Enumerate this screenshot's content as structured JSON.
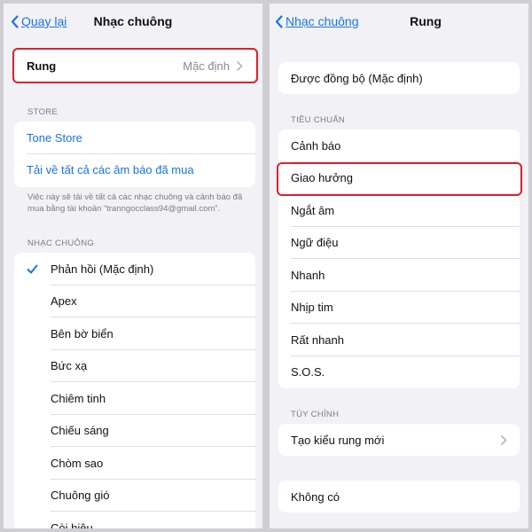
{
  "left": {
    "nav": {
      "back_label": "Quay lại",
      "title": "Nhạc chuông"
    },
    "vibration_row": {
      "label": "Rung",
      "value": "Mặc định"
    },
    "store": {
      "section_label": "STORE",
      "tone_store": "Tone Store",
      "download_all": "Tải về tất cả các âm báo đã mua",
      "footnote": "Việc này sẽ tải về tất cả các nhạc chuông và cảnh báo đã mua bằng tài khoản “tranngocclass94@gmail.com”."
    },
    "ringtones": {
      "section_label": "NHẠC CHUÔNG",
      "items": [
        {
          "label": "Phản hồi (Mặc định)",
          "selected": true
        },
        {
          "label": "Apex",
          "selected": false
        },
        {
          "label": "Bên bờ biển",
          "selected": false
        },
        {
          "label": "Bức xạ",
          "selected": false
        },
        {
          "label": "Chiêm tinh",
          "selected": false
        },
        {
          "label": "Chiếu sáng",
          "selected": false
        },
        {
          "label": "Chòm sao",
          "selected": false
        },
        {
          "label": "Chuông gió",
          "selected": false
        },
        {
          "label": "Còi hiệu",
          "selected": false
        }
      ]
    }
  },
  "right": {
    "nav": {
      "back_label": "Nhạc chuông",
      "title": "Rung"
    },
    "synced": {
      "label": "Được đồng bộ (Mặc định)"
    },
    "standard": {
      "section_label": "TIÊU CHUẨN",
      "items": [
        {
          "label": "Cảnh báo",
          "highlighted": false
        },
        {
          "label": "Giao hưởng",
          "highlighted": true
        },
        {
          "label": "Ngắt âm",
          "highlighted": false
        },
        {
          "label": "Ngữ điệu",
          "highlighted": false
        },
        {
          "label": "Nhanh",
          "highlighted": false
        },
        {
          "label": "Nhịp tim",
          "highlighted": false
        },
        {
          "label": "Rất nhanh",
          "highlighted": false
        },
        {
          "label": "S.O.S.",
          "highlighted": false
        }
      ]
    },
    "custom": {
      "section_label": "TÙY CHỈNH",
      "create_new": "Tạo kiểu rung mới"
    },
    "none": {
      "label": "Không có"
    }
  },
  "colors": {
    "accent": "#1a73e8",
    "highlight": "#e0202a",
    "background": "#f2f2f6"
  },
  "icons": {
    "back": "chevron-left-icon",
    "disclosure": "chevron-right-icon",
    "check": "checkmark-icon"
  }
}
